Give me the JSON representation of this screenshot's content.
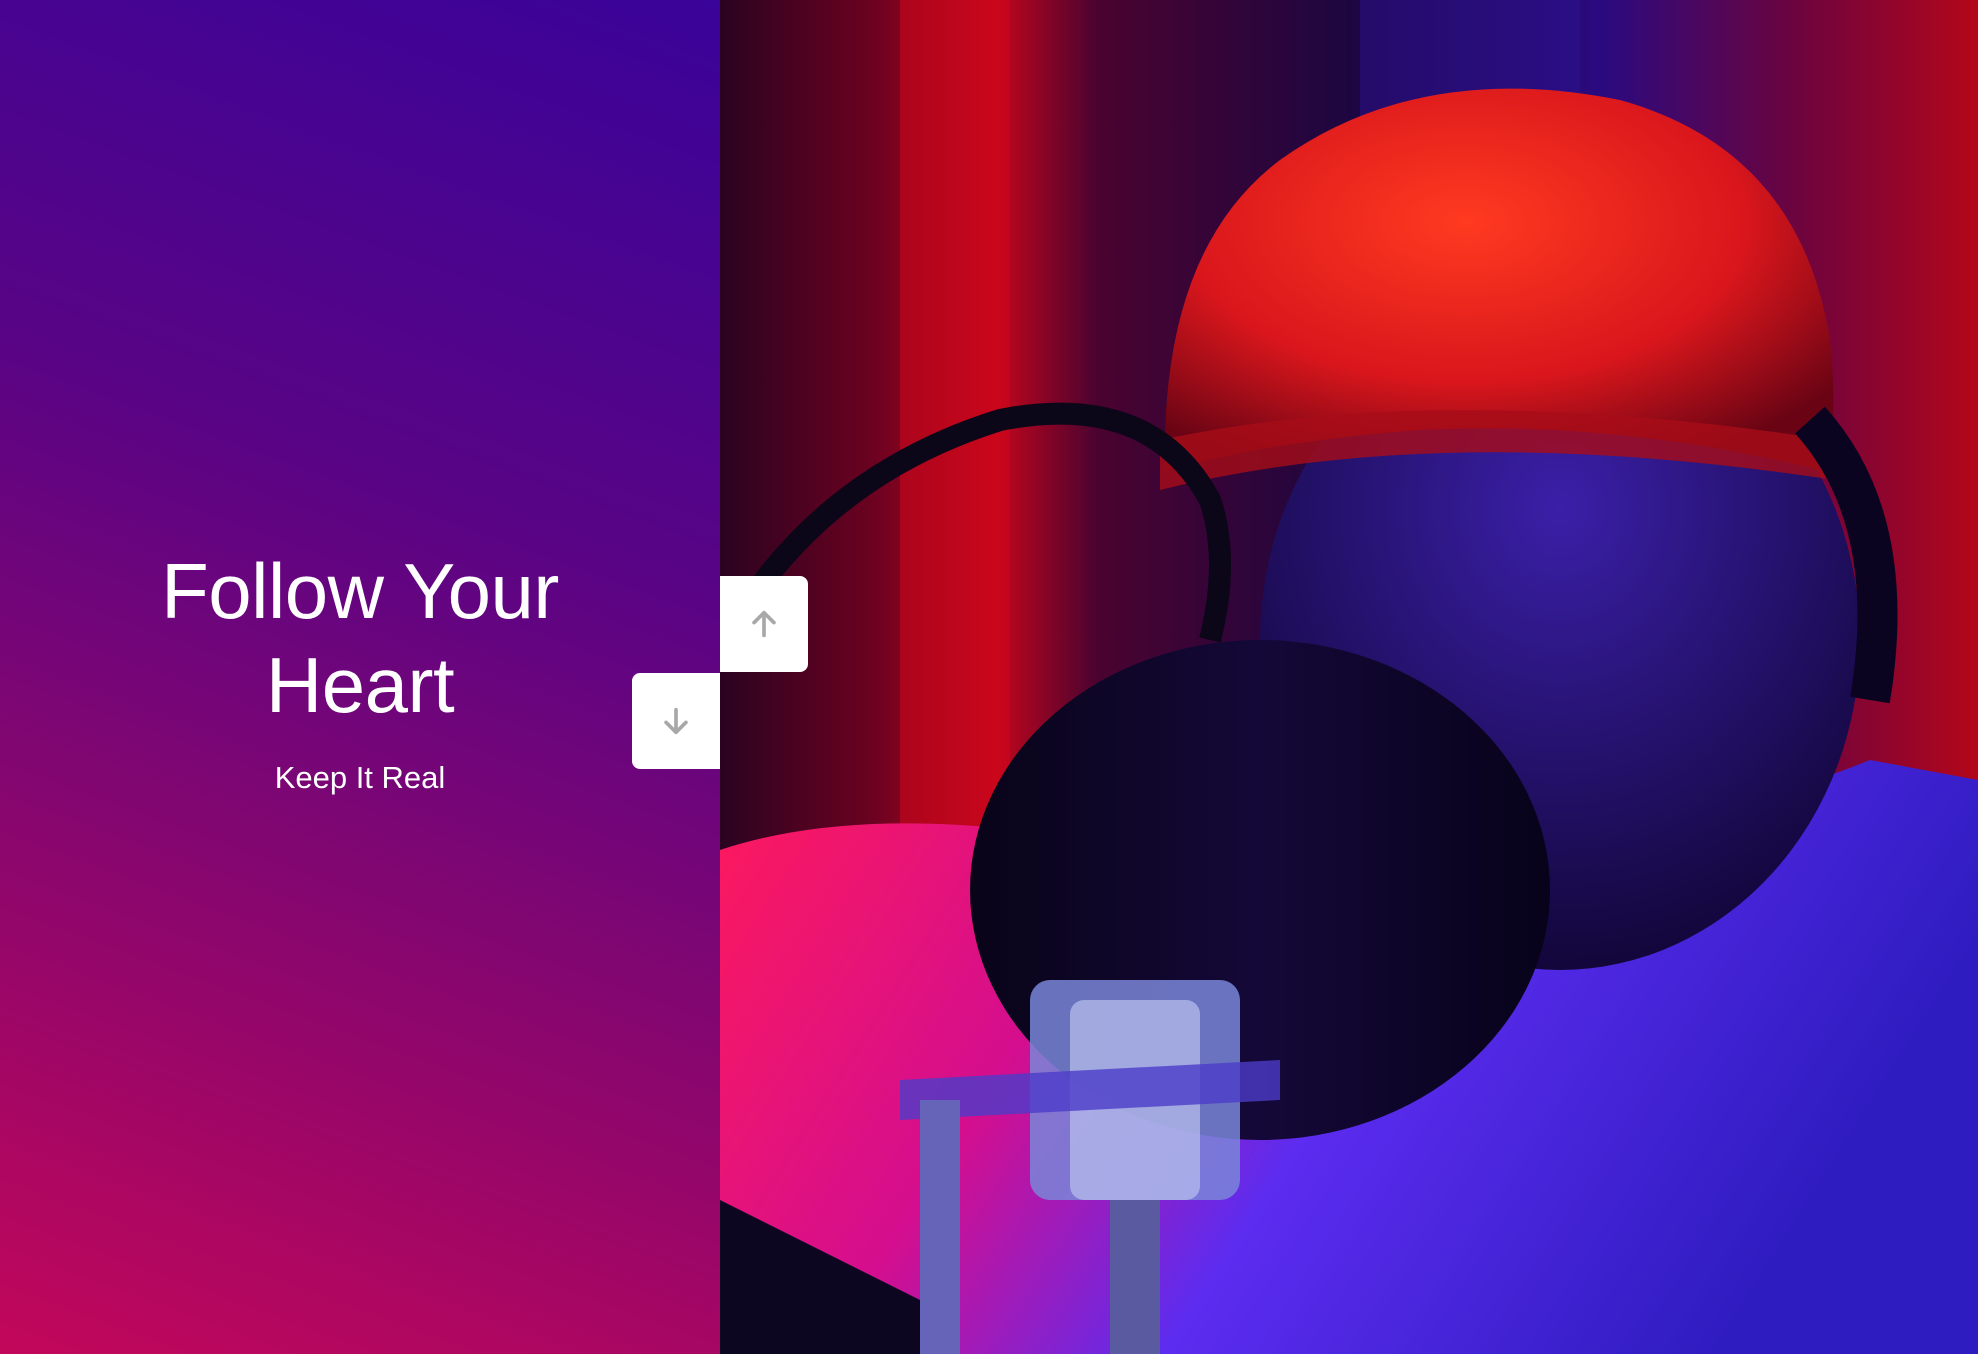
{
  "slide": {
    "title_line1": "Follow Your",
    "title_line2": "Heart",
    "subtitle": "Keep It Real"
  },
  "controls": {
    "up_icon": "arrow-up-icon",
    "down_icon": "arrow-down-icon",
    "icon_color": "#a8a8a8"
  },
  "colors": {
    "gradient_top": "#3a0399",
    "gradient_bottom": "#c2075a"
  },
  "image": {
    "subject": "photo-placeholder"
  }
}
